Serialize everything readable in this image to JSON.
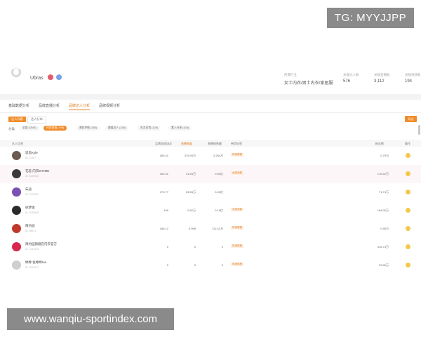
{
  "watermarks": {
    "tg": "TG: MYYJJPP",
    "url": "www.wanqiu-sportindex.com"
  },
  "header": {
    "brand": "Ubras",
    "stats": [
      {
        "label": "所属行业",
        "value": "女士内衣/男士内衣/家居服"
      },
      {
        "label": "关联达人数",
        "value": "576"
      },
      {
        "label": "关联直播数",
        "value": "3,112"
      },
      {
        "label": "关联视频数",
        "value": "194"
      }
    ]
  },
  "tabs": [
    "基础数据分析",
    "品牌直播分析",
    "品牌达人分析",
    "品牌视频分析"
  ],
  "active_tab": 2,
  "sub_tabs": [
    "达人列表",
    "达人分布"
  ],
  "export_label": "导出",
  "filter": {
    "label": "分类",
    "options": [
      "全部 (1545)",
      "时尚穿搭 (798)",
      "美妆护肤 (183)",
      "颜值达人 (165)",
      "生活日常 (125)",
      "素人分享 (104)"
    ],
    "active": 1
  },
  "table": {
    "headers": [
      "达人信息",
      "品牌关联场次",
      "直播销量",
      "直播销售额",
      "带货标签",
      "粉丝数",
      "操作"
    ],
    "rows": [
      {
        "name": "思思Kyle",
        "uid": "ID: 12357",
        "c1": "260.41",
        "c2": "375.94万",
        "c3": "2,284万",
        "tag": "时尚穿搭",
        "fans": "0.79万",
        "avatar": "#6b5a4e"
      },
      {
        "name": "花蕊 内衣EITIME",
        "uid": "ID: 2659582",
        "c1": "153.41",
        "c2": "31.64万",
        "c3": "0.50亿",
        "tag": "女性消费",
        "fans": "176.42万",
        "avatar": "#3a3a3a"
      },
      {
        "name": "朱迪",
        "uid": "ID: 6775300",
        "c1": "170.77",
        "c2": "25.53万",
        "c3": "0.00亿",
        "tag": "",
        "fans": "71.74万",
        "avatar": "#7b4fb3"
      },
      {
        "name": "徐梦姐",
        "uid": "ID: 3234848",
        "c1": "199",
        "c2": "0.62万",
        "c3": "0.15亿",
        "tag": "女性消费",
        "fans": "184.00万",
        "avatar": "#2b2b2b"
      },
      {
        "name": "简约园",
        "uid": "ID: 58873",
        "c1": "168.12",
        "c2": "9,999",
        "c3": "112.41万",
        "tag": "时尚穿搭",
        "fans": "0.95万",
        "avatar": "#c0392b"
      },
      {
        "name": "简约园旗舰店内衣官方",
        "uid": "ID: 1234378",
        "c1": "0",
        "c2": "0",
        "c3": "0",
        "tag": "时尚穿搭",
        "fans": "316.74万",
        "avatar": "#d6274d"
      },
      {
        "name": "婷婷 侯婷婷Ina",
        "uid": "ID: 9241217",
        "c1": "0",
        "c2": "0",
        "c3": "0",
        "tag": "时尚穿搭",
        "fans": "93.96万",
        "avatar": "#cfcfcf"
      }
    ]
  },
  "colors": {
    "accent": "#f08c2a",
    "tag_bg": "#fdeee0",
    "op_icon": "#f2c94c"
  }
}
